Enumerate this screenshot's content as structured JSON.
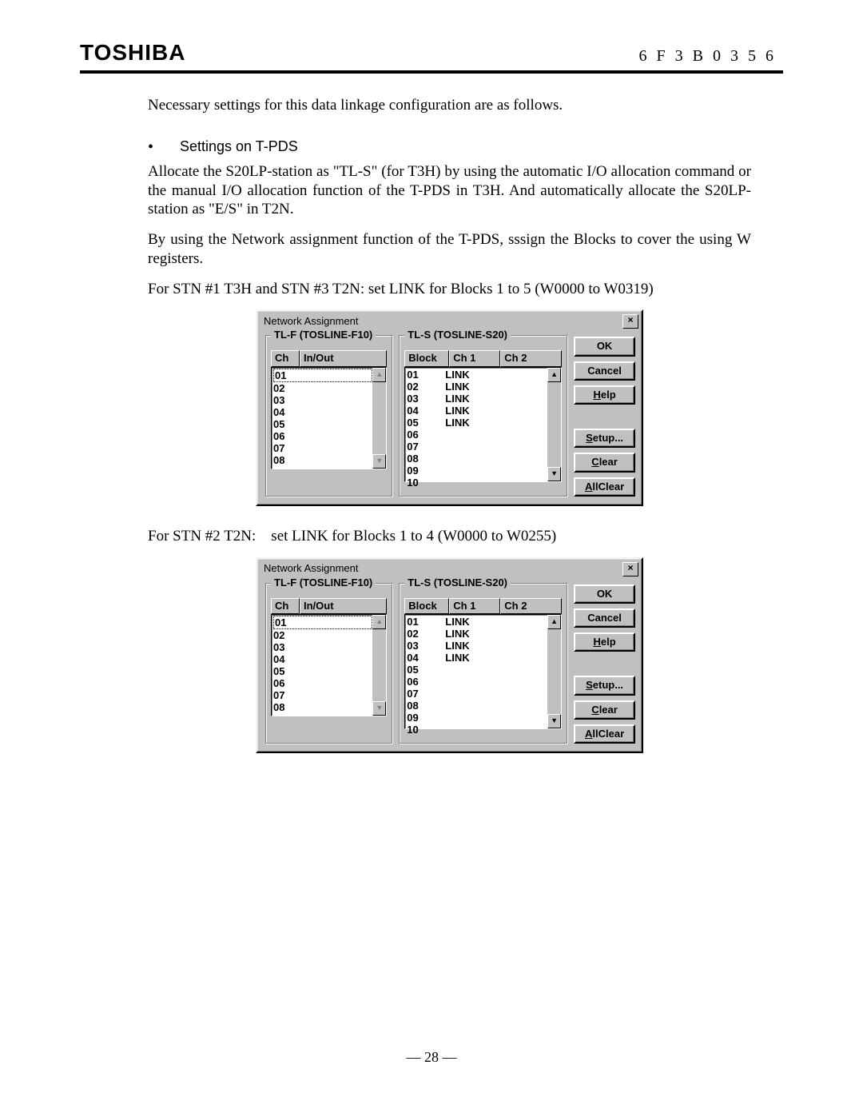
{
  "header": {
    "brand": "TOSHIBA",
    "docnum": "6F3B0356"
  },
  "text": {
    "intro": "Necessary settings for this data linkage configuration are as follows.",
    "bullet_label": "Settings on T-PDS",
    "p1": "Allocate the S20LP-station as \"TL-S\" (for T3H) by using the automatic I/O allocation command or the manual I/O allocation function of the T-PDS in T3H. And automatically allocate the S20LP-station as \"E/S\" in T2N.",
    "p2": "By using the Network assignment function of the T-PDS, sssign the Blocks to cover the using W registers.",
    "p3": "For STN #1 T3H and STN #3 T2N: set LINK for Blocks 1 to 5 (W0000 to W0319)",
    "p4": "For STN #2 T2N:    set LINK for Blocks 1 to 4 (W0000 to W0255)"
  },
  "dialog": {
    "title": "Network Assignment",
    "close": "×",
    "tlf_legend": "TL-F (TOSLINE-F10)",
    "tls_legend": "TL-S (TOSLINE-S20)",
    "hdr_ch": "Ch",
    "hdr_io": "In/Out",
    "hdr_block": "Block",
    "hdr_ch1": "Ch 1",
    "hdr_ch2": "Ch 2",
    "btn_ok": "OK",
    "btn_cancel": "Cancel",
    "btn_help_pre": "H",
    "btn_help_post": "elp",
    "btn_setup_pre": "S",
    "btn_setup_post": "etup...",
    "btn_clear_pre": "C",
    "btn_clear_post": "lear",
    "btn_allclear_pre": "A",
    "btn_allclear_post": "llClear",
    "arrow_up": "▲",
    "arrow_down": "▼"
  },
  "dialog1": {
    "tlf_rows": [
      "01",
      "02",
      "03",
      "04",
      "05",
      "06",
      "07",
      "08"
    ],
    "tls_rows": [
      {
        "b": "01",
        "c1": "LINK",
        "c2": ""
      },
      {
        "b": "02",
        "c1": "LINK",
        "c2": ""
      },
      {
        "b": "03",
        "c1": "LINK",
        "c2": ""
      },
      {
        "b": "04",
        "c1": "LINK",
        "c2": ""
      },
      {
        "b": "05",
        "c1": "LINK",
        "c2": ""
      },
      {
        "b": "06",
        "c1": "",
        "c2": ""
      },
      {
        "b": "07",
        "c1": "",
        "c2": ""
      },
      {
        "b": "08",
        "c1": "",
        "c2": ""
      },
      {
        "b": "09",
        "c1": "",
        "c2": ""
      },
      {
        "b": "10",
        "c1": "",
        "c2": ""
      }
    ]
  },
  "dialog2": {
    "tlf_rows": [
      "01",
      "02",
      "03",
      "04",
      "05",
      "06",
      "07",
      "08"
    ],
    "tls_rows": [
      {
        "b": "01",
        "c1": "LINK",
        "c2": ""
      },
      {
        "b": "02",
        "c1": "LINK",
        "c2": ""
      },
      {
        "b": "03",
        "c1": "LINK",
        "c2": ""
      },
      {
        "b": "04",
        "c1": "LINK",
        "c2": ""
      },
      {
        "b": "05",
        "c1": "",
        "c2": ""
      },
      {
        "b": "06",
        "c1": "",
        "c2": ""
      },
      {
        "b": "07",
        "c1": "",
        "c2": ""
      },
      {
        "b": "08",
        "c1": "",
        "c2": ""
      },
      {
        "b": "09",
        "c1": "",
        "c2": ""
      },
      {
        "b": "10",
        "c1": "",
        "c2": ""
      }
    ]
  },
  "footer": {
    "page": "— 28 —"
  }
}
